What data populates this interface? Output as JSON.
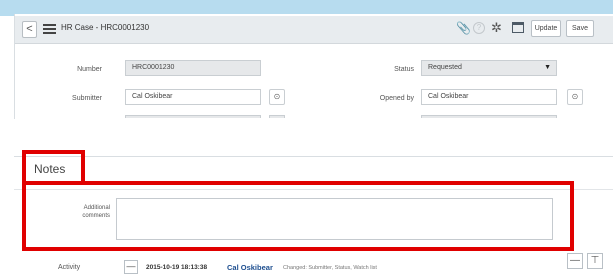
{
  "header": {
    "back_glyph": "<",
    "title": "HR Case - HRC0001230",
    "help_glyph": "?",
    "attachment_icon": "paperclip-icon",
    "activity_icon": "pulse-icon",
    "window_icon": "window-icon",
    "update_label": "Update",
    "save_label": "Save"
  },
  "form": {
    "number_label": "Number",
    "number_value": "HRC0001230",
    "submitter_label": "Submitter",
    "submitter_value": "Cal Oskibear",
    "status_label": "Status",
    "status_value": "Requested",
    "opened_by_label": "Opened by",
    "opened_by_value": "Cal Oskibear",
    "ref_glyph": "⊙",
    "dropdown_glyph": "▼"
  },
  "notes": {
    "section_title": "Notes",
    "additional_comments_label": "Additional comments",
    "additional_comments_value": ""
  },
  "activity": {
    "label": "Activity",
    "collapse_glyph": "—",
    "timestamp": "2015-10-19 18:13:38",
    "user": "Cal Oskibear",
    "change": "Changed: Submitter, Status, Watch list",
    "minus_glyph": "—",
    "filter_glyph": "⊤"
  },
  "colors": {
    "highlight": "#e00000",
    "header_bg": "#e8ecef",
    "top_accent": "#b7dcef",
    "user_link": "#1d4e8f"
  }
}
